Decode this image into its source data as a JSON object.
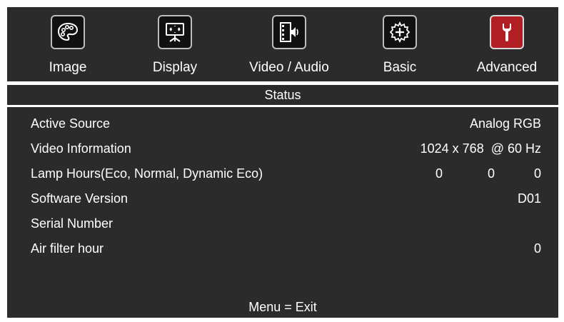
{
  "tabs": [
    {
      "label": "Image",
      "icon": "palette-icon"
    },
    {
      "label": "Display",
      "icon": "display-screen-icon"
    },
    {
      "label": "Video / Audio",
      "icon": "video-audio-icon"
    },
    {
      "label": "Basic",
      "icon": "gear-icon"
    },
    {
      "label": "Advanced",
      "icon": "wrench-icon",
      "active": true
    }
  ],
  "section_title": "Status",
  "rows": {
    "active_source": {
      "label": "Active Source",
      "value": "Analog RGB"
    },
    "video_information": {
      "label": "Video Information",
      "value": "1024 x 768  @ 60 Hz"
    },
    "lamp_hours": {
      "label": "Lamp Hours(Eco, Normal, Dynamic Eco)",
      "values": [
        "0",
        "0",
        "0"
      ]
    },
    "software_version": {
      "label": "Software Version",
      "value": "D01"
    },
    "serial_number": {
      "label": "Serial Number",
      "value": ""
    },
    "air_filter_hour": {
      "label": "Air filter hour",
      "value": "0"
    }
  },
  "footer": "Menu = Exit",
  "colors": {
    "background": "#2b2b2b",
    "active_tab": "#b11e24",
    "text": "#ffffff"
  }
}
